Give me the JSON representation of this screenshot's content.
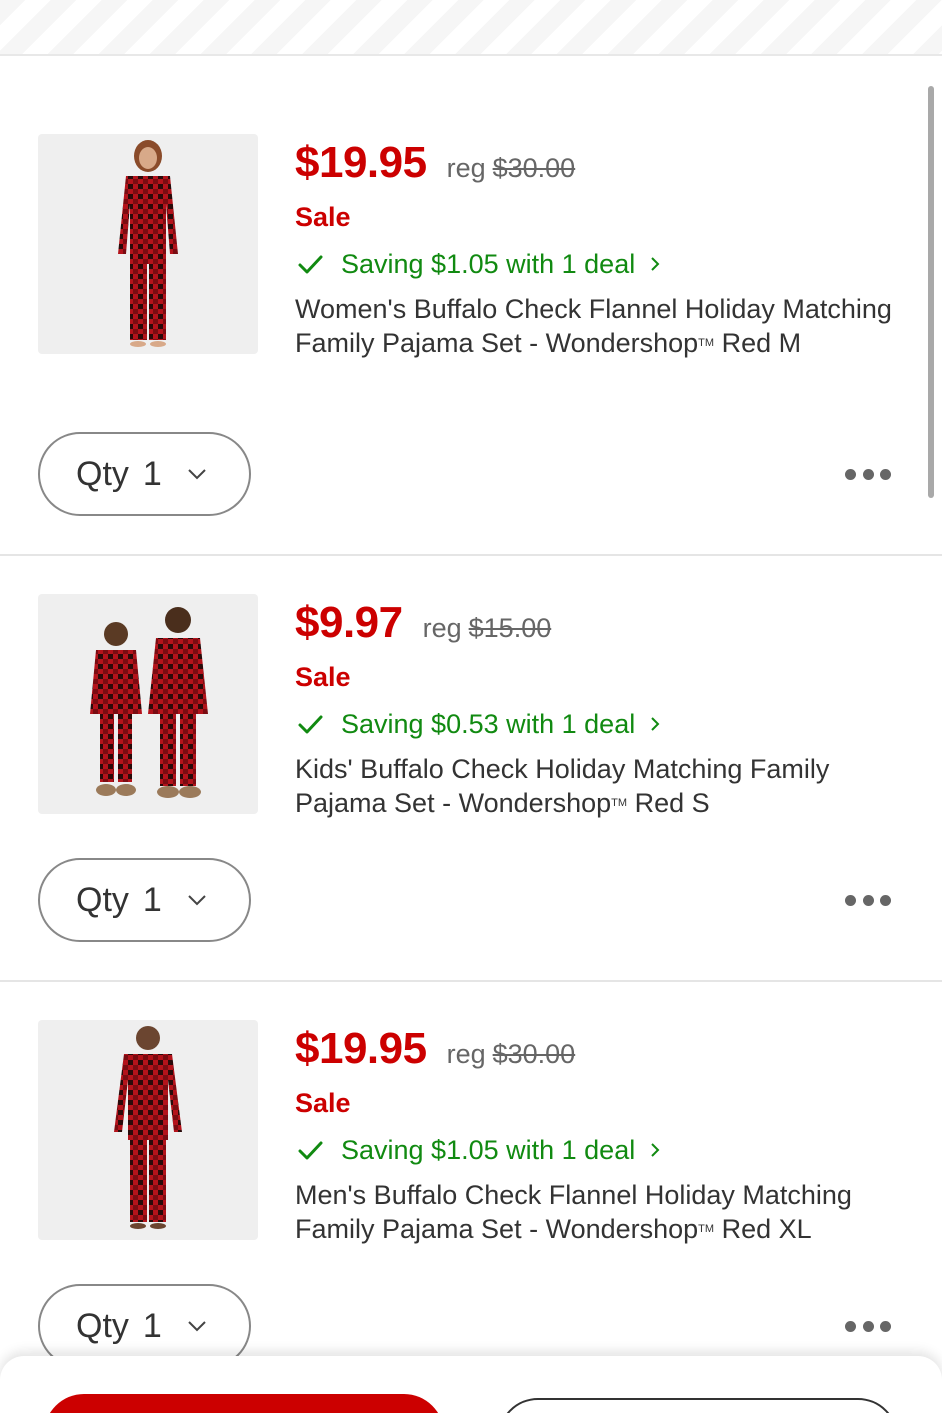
{
  "cart": {
    "items": [
      {
        "price": "$19.95",
        "reg_label": "reg",
        "reg_price": "$30.00",
        "sale_label": "Sale",
        "deal_text": "Saving $1.05 with 1 deal",
        "title_part1": "Women's Buffalo Check Flannel Holiday Matching Family Pajama Set - Wondershop",
        "tm": "TM",
        "title_part2": "Red M",
        "qty_label": "Qty",
        "qty_value": "1",
        "image_desc": "woman-red-buffalo-check-pajamas"
      },
      {
        "price": "$9.97",
        "reg_label": "reg",
        "reg_price": "$15.00",
        "sale_label": "Sale",
        "deal_text": "Saving $0.53 with 1 deal",
        "title_part1": "Kids' Buffalo Check Holiday Matching Family Pajama Set - Wondershop",
        "tm": "TM",
        "title_part2": "Red S",
        "qty_label": "Qty",
        "qty_value": "1",
        "image_desc": "kids-red-buffalo-check-pajamas"
      },
      {
        "price": "$19.95",
        "reg_label": "reg",
        "reg_price": "$30.00",
        "sale_label": "Sale",
        "deal_text": "Saving $1.05 with 1 deal",
        "title_part1": "Men's Buffalo Check Flannel Holiday Matching Family Pajama Set - Wondershop",
        "tm": "TM",
        "title_part2": "Red XL",
        "qty_label": "Qty",
        "qty_value": "1",
        "image_desc": "man-red-buffalo-check-pajamas"
      }
    ]
  },
  "colors": {
    "sale_red": "#cc0000",
    "deal_green": "#118a11",
    "text_dark": "#333333"
  },
  "icons": {
    "check": "check-icon",
    "deal_chevron": "chevron-right-icon",
    "qty_chevron": "chevron-down-icon",
    "more": "more-horizontal-icon"
  }
}
